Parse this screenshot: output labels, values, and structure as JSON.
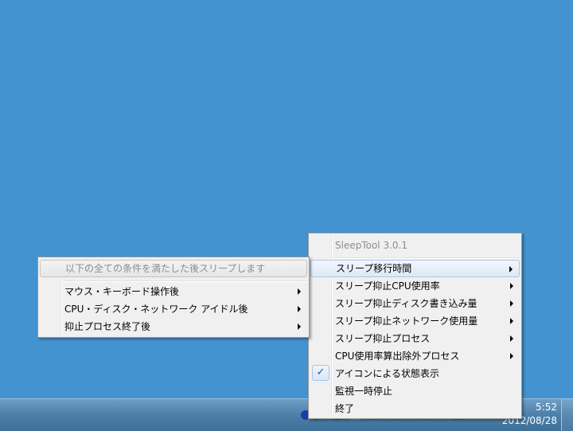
{
  "taskbar": {
    "clock_time": "5:52",
    "clock_date": "2012/08/28",
    "tray_icon_colors": [
      "#1a3fa0",
      "#d0202a",
      "#3a6a30",
      "#c89a20",
      "#2c8a40",
      "#6a6a6a",
      "#3a70b0",
      "#b03030",
      "#4a8a4a",
      "#2a5aa0"
    ]
  },
  "main_menu": {
    "title": "SleepTool 3.0.1",
    "items": [
      {
        "label": "スリープ移行時間",
        "has_submenu": true
      },
      {
        "label": "スリープ抑止CPU使用率",
        "has_submenu": true
      },
      {
        "label": "スリープ抑止ディスク書き込み量",
        "has_submenu": true
      },
      {
        "label": "スリープ抑止ネットワーク使用量",
        "has_submenu": true
      },
      {
        "label": "スリープ抑止プロセス",
        "has_submenu": true
      },
      {
        "label": "CPU使用率算出除外プロセス",
        "has_submenu": true
      },
      {
        "label": "アイコンによる状態表示",
        "checked": true
      },
      {
        "label": "監視一時停止"
      },
      {
        "label": "終了"
      }
    ],
    "check_glyph": "✓"
  },
  "sub_menu": {
    "header": "以下の全ての条件を満たした後スリープします",
    "items": [
      {
        "label": "マウス・キーボード操作後"
      },
      {
        "label": "CPU・ディスク・ネットワーク アイドル後"
      },
      {
        "label": "抑止プロセス終了後"
      }
    ]
  },
  "colors": {
    "desktop": "#4293d0",
    "menu_background": "#f0f0f0",
    "highlight_border": "#a9c6e8",
    "check": "#1c5ab8",
    "disabled_text": "#8d8d8d"
  }
}
